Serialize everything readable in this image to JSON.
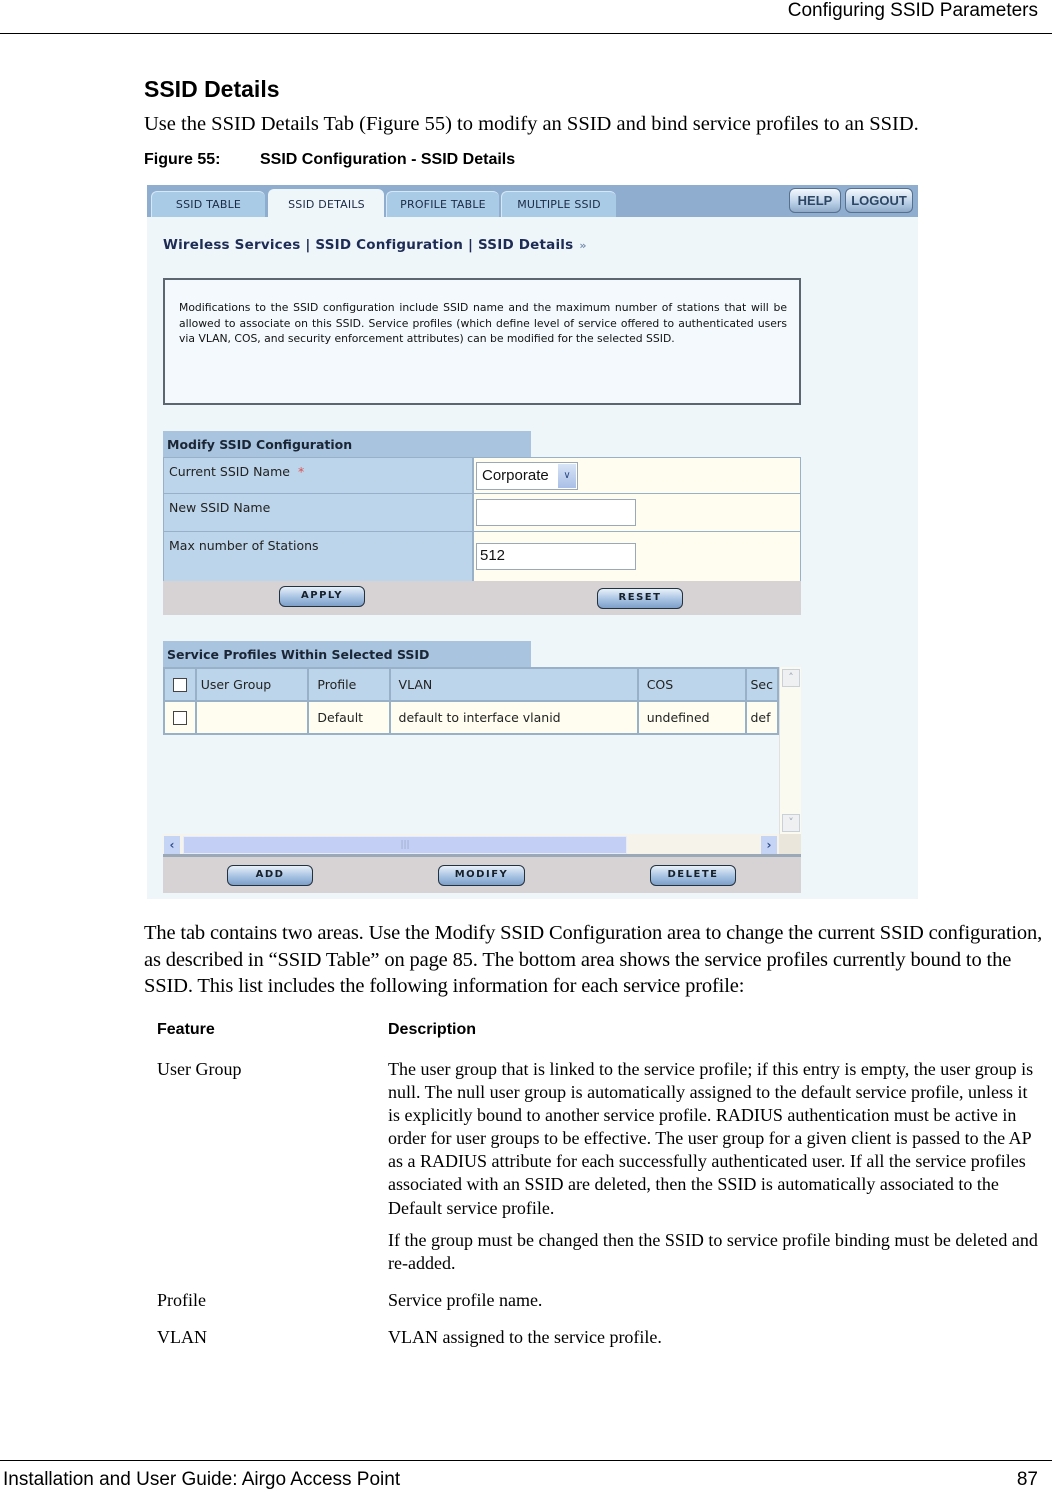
{
  "document": {
    "header_title": "Configuring SSID Parameters",
    "section_title": "SSID Details",
    "intro": "Use the SSID Details Tab (Figure 55) to modify an SSID and bind service profiles to an SSID.",
    "figure": {
      "number": "Figure 55:",
      "caption": "SSID Configuration - SSID Details"
    },
    "body_paragraph": "The tab contains two areas. Use the Modify SSID Configuration area to change the current SSID configuration, as described in “SSID Table” on page 85. The bottom area shows the service profiles currently bound to the SSID. This list includes the following information for each service profile:",
    "feature_table": {
      "headers": {
        "feature": "Feature",
        "description": "Description"
      },
      "rows": [
        {
          "feature": "User Group",
          "description": [
            "The user group that is linked to the service profile; if this entry is empty, the user group is null. The null user group is automatically assigned to the default service profile, unless it is explicitly bound to another service profile. RADIUS authentication must be active in order for user groups to be effective. The user group for a given client is passed to the AP as a RADIUS attribute for each successfully authenticated user. If all the service profiles associated with an SSID are deleted, then the SSID is automatically associated to the Default service profile.",
            "If the group must be changed then the SSID to service profile binding must be deleted and re-added."
          ]
        },
        {
          "feature": "Profile",
          "description": [
            "Service profile name."
          ]
        },
        {
          "feature": "VLAN",
          "description": [
            "VLAN assigned to the service profile."
          ]
        }
      ]
    },
    "footer": {
      "title": "Installation and User Guide: Airgo Access Point",
      "page_number": "87"
    }
  },
  "ui": {
    "tabs": [
      {
        "label": "SSID TABLE",
        "active": false
      },
      {
        "label": "SSID DETAILS",
        "active": true
      },
      {
        "label": "PROFILE TABLE",
        "active": false
      },
      {
        "label": "MULTIPLE SSID",
        "active": false
      }
    ],
    "top_buttons": {
      "help": "HELP",
      "logout": "LOGOUT"
    },
    "breadcrumb": {
      "text": "Wireless Services | SSID Configuration | SSID Details",
      "arrows": "»"
    },
    "info_text": "Modifications to the SSID configuration include SSID name and the maximum number of stations that will be allowed to associate on this SSID. Service profiles (which define level of service offered to authenticated users via VLAN, COS, and security enforcement attributes) can be modified for the selected SSID.",
    "modify_panel": {
      "title": "Modify SSID Configuration",
      "fields": {
        "current_ssid": {
          "label": "Current SSID Name",
          "required_mark": "*",
          "value": "Corporate",
          "arrow": "∨"
        },
        "new_ssid": {
          "label": "New SSID Name",
          "value": ""
        },
        "max_stations": {
          "label": "Max number of Stations",
          "value": "512"
        }
      },
      "buttons": {
        "apply": "APPLY",
        "reset": "RESET"
      }
    },
    "profiles_panel": {
      "title": "Service Profiles Within Selected SSID",
      "columns": [
        "User Group",
        "Profile",
        "VLAN",
        "COS",
        "Sec"
      ],
      "rows": [
        {
          "user_group": "",
          "profile": "Default",
          "vlan": "default to interface vlanid",
          "cos": "undefined",
          "security": "def"
        }
      ],
      "scroll": {
        "up": "˄",
        "down": "˅",
        "left": "‹",
        "right": "›",
        "grip": "|||"
      },
      "buttons": {
        "add": "ADD",
        "modify": "MODIFY",
        "delete": "DELETE"
      }
    }
  }
}
